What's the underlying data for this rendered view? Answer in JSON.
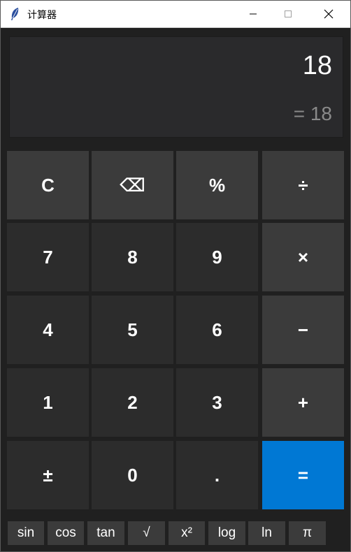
{
  "window": {
    "title": "计算器"
  },
  "display": {
    "expression": "18",
    "result": "= 18"
  },
  "keys": {
    "clear": "C",
    "backspace": "⌫",
    "percent": "%",
    "divide": "÷",
    "seven": "7",
    "eight": "8",
    "nine": "9",
    "multiply": "×",
    "four": "4",
    "five": "5",
    "six": "6",
    "minus": "−",
    "one": "1",
    "two": "2",
    "three": "3",
    "plus": "+",
    "plusminus": "±",
    "zero": "0",
    "dot": ".",
    "equals": "="
  },
  "functions": {
    "sin": "sin",
    "cos": "cos",
    "tan": "tan",
    "sqrt": "√",
    "square": "x²",
    "log": "log",
    "ln": "ln",
    "pi": "π"
  },
  "colors": {
    "accent": "#0078d4",
    "background": "#202020",
    "key_light": "#3b3b3b",
    "key_dark": "#2c2c2c"
  }
}
